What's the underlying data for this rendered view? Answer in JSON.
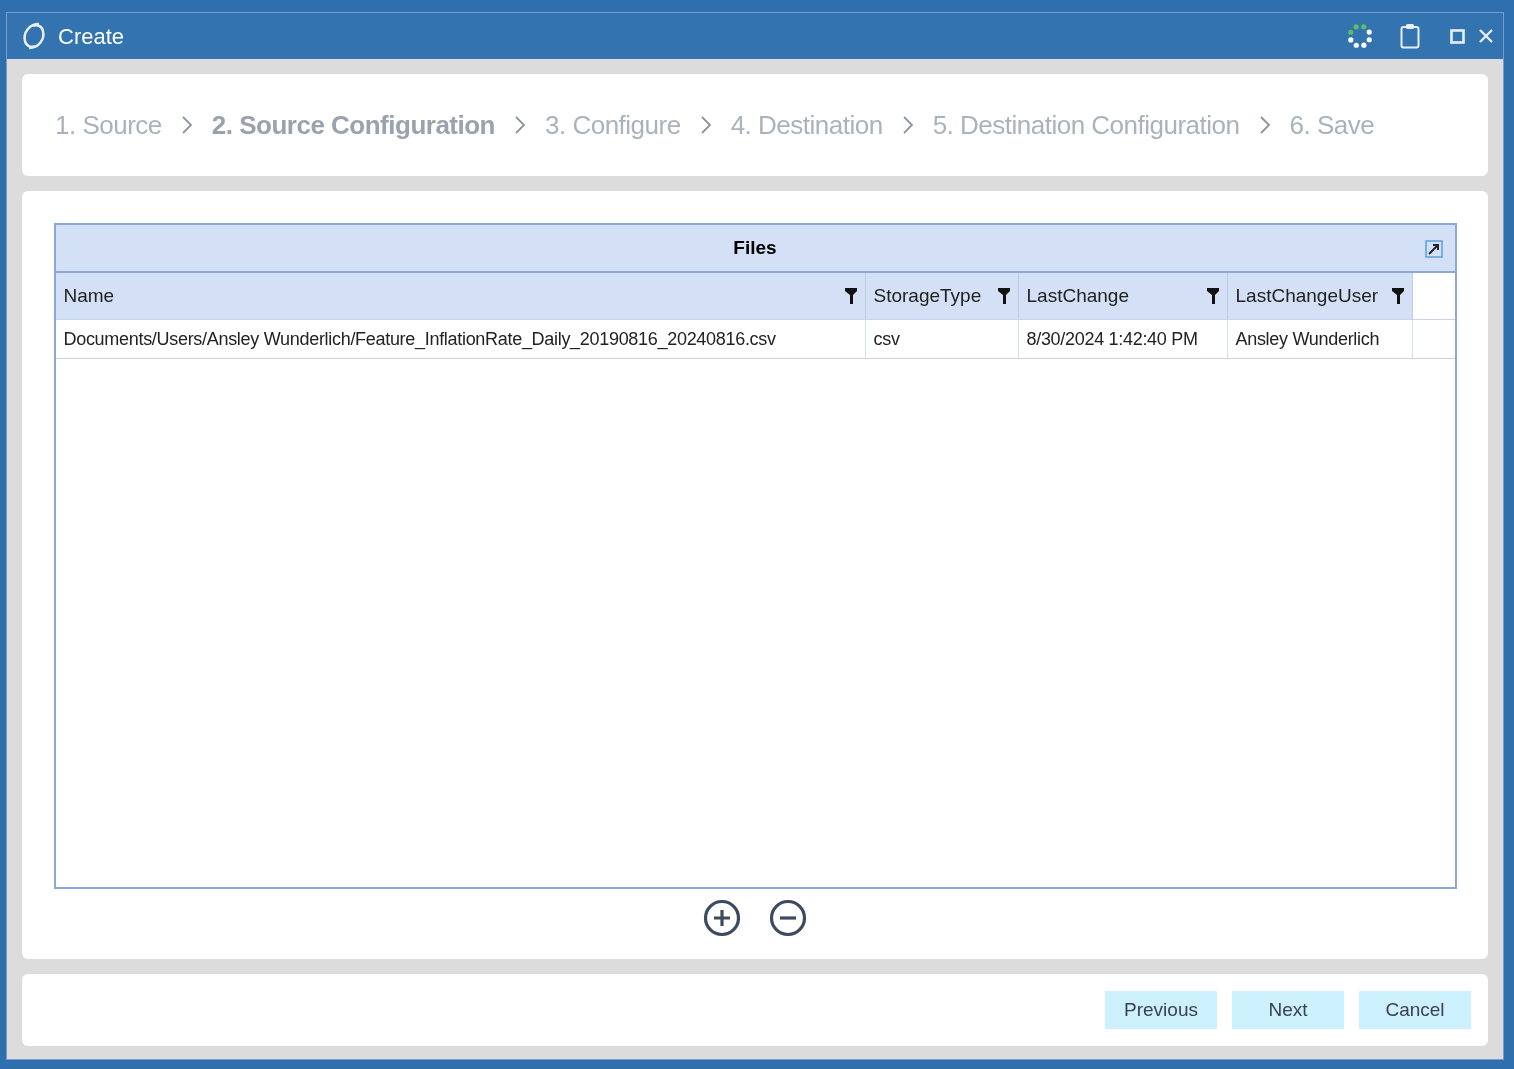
{
  "window": {
    "title": "Create"
  },
  "steps": [
    {
      "label": "1. Source",
      "selected": false
    },
    {
      "label": "2. Source Configuration",
      "selected": true
    },
    {
      "label": "3. Configure",
      "selected": false
    },
    {
      "label": "4. Destination",
      "selected": false
    },
    {
      "label": "5. Destination Configuration",
      "selected": false
    },
    {
      "label": "6. Save",
      "selected": false
    }
  ],
  "table": {
    "title": "Files",
    "columns": [
      {
        "label": "Name",
        "filter": true
      },
      {
        "label": "StorageType",
        "filter": true
      },
      {
        "label": "LastChange",
        "filter": true
      },
      {
        "label": "LastChangeUser",
        "filter": true
      }
    ],
    "rows": [
      [
        "Documents/Users/Ansley Wunderlich/Feature_InflationRate_Daily_20190816_20240816.csv",
        "csv",
        "8/30/2024 1:42:40 PM",
        "Ansley Wunderlich"
      ]
    ]
  },
  "buttons": [
    "Previous",
    "Next",
    "Cancel"
  ]
}
